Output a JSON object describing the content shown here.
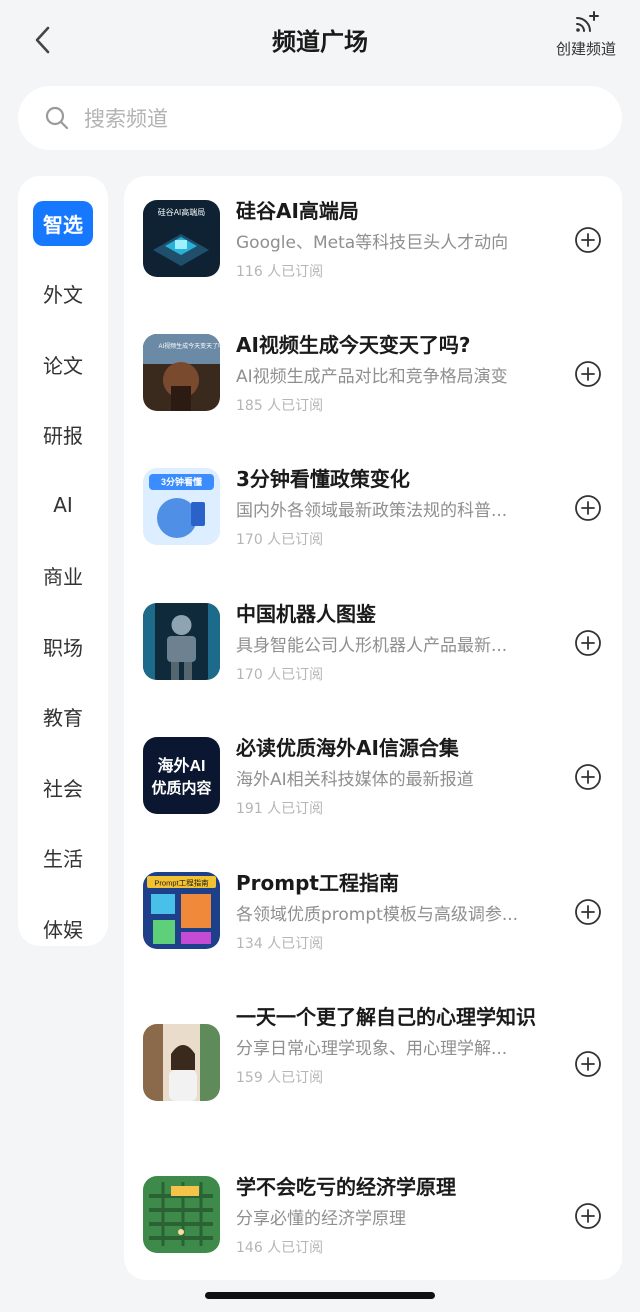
{
  "header": {
    "title": "频道广场",
    "back_icon": "chevron-left-icon",
    "create_label": "创建频道",
    "create_icon": "broadcast-plus-icon"
  },
  "search": {
    "placeholder": "搜索频道",
    "icon": "search-icon"
  },
  "sidebar": {
    "items": [
      {
        "label": "智选",
        "active": true
      },
      {
        "label": "外文",
        "active": false
      },
      {
        "label": "论文",
        "active": false
      },
      {
        "label": "研报",
        "active": false
      },
      {
        "label": "AI",
        "active": false
      },
      {
        "label": "商业",
        "active": false
      },
      {
        "label": "职场",
        "active": false
      },
      {
        "label": "教育",
        "active": false
      },
      {
        "label": "社会",
        "active": false
      },
      {
        "label": "生活",
        "active": false
      },
      {
        "label": "体娱",
        "active": false
      }
    ],
    "active_color": "#1677ff"
  },
  "channels": [
    {
      "title": "硅谷AI高端局",
      "desc": "Google、Meta等科技巨头人才动向",
      "subs": "116 人已订阅",
      "thumb_text": "硅谷AI高端局"
    },
    {
      "title": "AI视频生成今天变天了吗?",
      "desc": "AI视频生成产品对比和竞争格局演变",
      "subs": "185 人已订阅",
      "thumb_text": "AI视频生成今天变天了吗?"
    },
    {
      "title": "3分钟看懂政策变化",
      "desc": "国内外各领域最新政策法规的科普...",
      "subs": "170 人已订阅",
      "thumb_text": "3分钟看懂"
    },
    {
      "title": "中国机器人图鉴",
      "desc": "具身智能公司人形机器人产品最新...",
      "subs": "170 人已订阅",
      "thumb_text": ""
    },
    {
      "title": "必读优质海外AI信源合集",
      "desc": "海外AI相关科技媒体的最新报道",
      "subs": "191 人已订阅",
      "thumb_text": "海外AI 优质内容"
    },
    {
      "title": "Prompt工程指南",
      "desc": "各领域优质prompt模板与高级调参...",
      "subs": "134 人已订阅",
      "thumb_text": "Prompt工程指南"
    },
    {
      "title": "一天一个更了解自己的心理学知识",
      "desc": "分享日常心理学现象、用心理学解...",
      "subs": "159 人已订阅",
      "thumb_text": ""
    },
    {
      "title": "学不会吃亏的经济学原理",
      "desc": "分享必懂的经济学原理",
      "subs": "146 人已订阅",
      "thumb_text": ""
    }
  ],
  "add_icon": "plus-circle-icon"
}
